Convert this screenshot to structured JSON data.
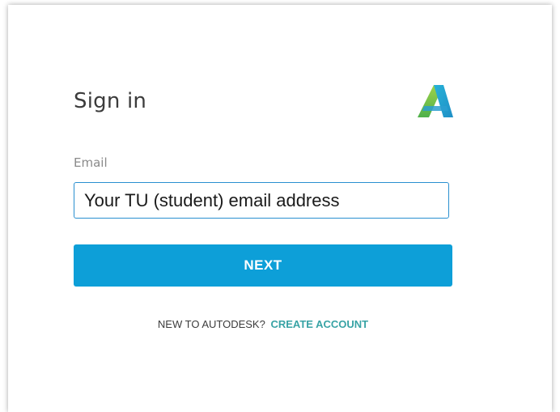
{
  "signin": {
    "title": "Sign in",
    "logo_icon": "autodesk-logo-icon",
    "email_label": "Email",
    "email_value": "Your TU (student) email address",
    "next_label": "NEXT",
    "new_prompt": "NEW TO AUTODESK?",
    "create_account_label": "CREATE ACCOUNT"
  },
  "colors": {
    "accent_blue": "#0d9fd8",
    "link_teal": "#38a3a5",
    "field_border": "#2a8fd0"
  }
}
